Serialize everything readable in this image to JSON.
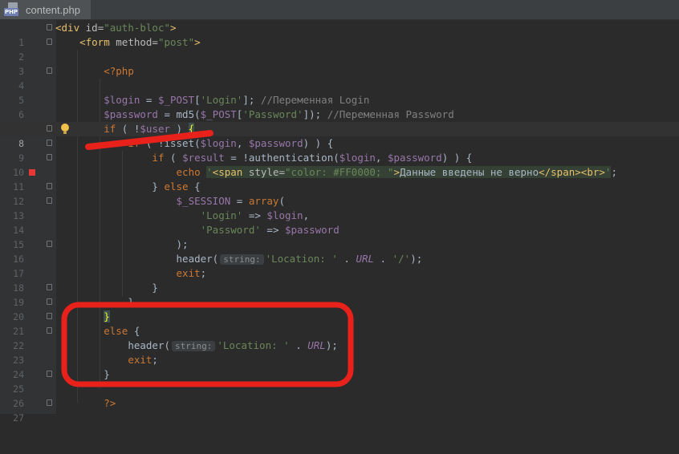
{
  "tab": {
    "filename": "content.php",
    "icon_badge": "PHP"
  },
  "editor": {
    "current_line": "8",
    "breakpoint_line": "11",
    "lines": [
      {
        "n": "1"
      },
      {
        "n": "2"
      },
      {
        "n": "3"
      },
      {
        "n": "4"
      },
      {
        "n": "5"
      },
      {
        "n": "6"
      },
      {
        "n": "7"
      },
      {
        "n": "8"
      },
      {
        "n": "9"
      },
      {
        "n": "10"
      },
      {
        "n": "11"
      },
      {
        "n": "12"
      },
      {
        "n": "13"
      },
      {
        "n": "14"
      },
      {
        "n": "15"
      },
      {
        "n": "16"
      },
      {
        "n": "17"
      },
      {
        "n": "18"
      },
      {
        "n": "19"
      },
      {
        "n": "20"
      },
      {
        "n": "21"
      },
      {
        "n": "22"
      },
      {
        "n": "23"
      },
      {
        "n": "24"
      },
      {
        "n": "25"
      },
      {
        "n": "26"
      },
      {
        "n": "27"
      }
    ],
    "code": {
      "l1": {
        "open": "<div ",
        "attr": "id=",
        "val": "\"auth-bloc\"",
        "close": ">"
      },
      "l2": {
        "open": "<form ",
        "attr": "method=",
        "val": "\"post\"",
        "close": ">"
      },
      "l4": {
        "tag": "<?php"
      },
      "l6": {
        "var": "$login",
        "op": " = ",
        "var2": "$_POST",
        "br1": "[",
        "str": "'Login'",
        "br2": "];",
        "cmt": " //Переменная Login"
      },
      "l7": {
        "var": "$password",
        "op": " = ",
        "fn": "md5(",
        "var2": "$_POST",
        "br1": "[",
        "str": "'Password'",
        "br2": "]);",
        "cmt": " //Переменная Password"
      },
      "l8": {
        "kw": "if",
        "rest": " ( !",
        "var": "$user",
        "rest2": " ) ",
        "brace": "{"
      },
      "l9": {
        "kw": "if",
        "rest": " ( !",
        "fn": "isset",
        "p1": "(",
        "var": "$login",
        "c": ", ",
        "var2": "$password",
        "p2": ") ) {"
      },
      "l10": {
        "kw": "if",
        "rest": " ( ",
        "var": "$result",
        "op": " = !",
        "fn": "authentication",
        "p1": "(",
        "var2": "$login",
        "c": ", ",
        "var3": "$password",
        "p2": ") ) {"
      },
      "l11": {
        "kw": "echo",
        "q1": "'",
        "tag1": "<span",
        "attr": " style=",
        "sval": "\"color: #FF0000; \"",
        "tag1c": ">",
        "text": "Данные введены не верно",
        "tag2": "</span><br>",
        "q2": "'",
        "end": ";"
      },
      "l12": {
        "b": "} ",
        "kw": "else",
        "b2": " {"
      },
      "l13": {
        "var": "$_SESSION",
        "op": " = ",
        "kw": "array",
        "p": "("
      },
      "l14": {
        "str": "'Login'",
        "op": " => ",
        "var": "$login",
        "c": ","
      },
      "l15": {
        "str": "'Password'",
        "op": " => ",
        "var": "$password"
      },
      "l16": {
        "t": ");"
      },
      "l17": {
        "fn": "header(",
        "hint": "string:",
        "str": "'Location: '",
        "op": " . ",
        "const": "URL",
        "op2": " . ",
        "str2": "'/'",
        "end": ");"
      },
      "l18": {
        "kw": "exit",
        "end": ";"
      },
      "l19": {
        "t": "}"
      },
      "l20": {
        "t": "}"
      },
      "l21": {
        "brace": "}"
      },
      "l22": {
        "kw": "else",
        "t": " {"
      },
      "l23": {
        "fn": "header(",
        "hint": "string:",
        "str": "'Location: '",
        "op": " . ",
        "const": "URL",
        "end": ");"
      },
      "l24": {
        "kw": "exit",
        "end": ";"
      },
      "l25": {
        "t": "}"
      },
      "l27": {
        "tag": "?>"
      }
    }
  },
  "annotations": {
    "color": "#e8211b"
  }
}
